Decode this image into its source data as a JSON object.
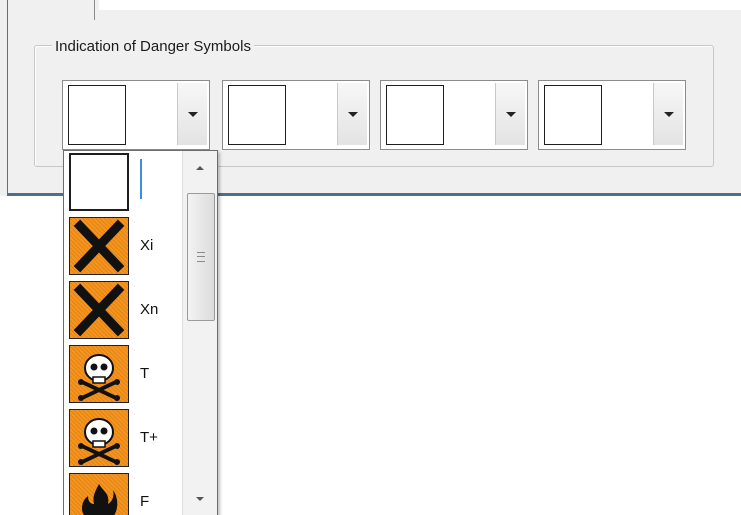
{
  "group": {
    "title": "Indication of Danger Symbols"
  },
  "combos": [
    {
      "label": "Danger symbol selector 1"
    },
    {
      "label": "Danger symbol selector 2"
    },
    {
      "label": "Danger symbol selector 3"
    },
    {
      "label": "Danger symbol selector 4"
    }
  ],
  "dropdown": {
    "items": [
      {
        "code": "",
        "icon": "blank"
      },
      {
        "code": "Xi",
        "icon": "cross-icon"
      },
      {
        "code": "Xn",
        "icon": "cross-icon"
      },
      {
        "code": "T",
        "icon": "skull-crossbones-icon"
      },
      {
        "code": "T+",
        "icon": "skull-crossbones-icon"
      },
      {
        "code": "F",
        "icon": "flame-icon"
      }
    ]
  },
  "colors": {
    "hazard_orange": "#f7941d",
    "selection_caret": "#3c8ce6"
  }
}
